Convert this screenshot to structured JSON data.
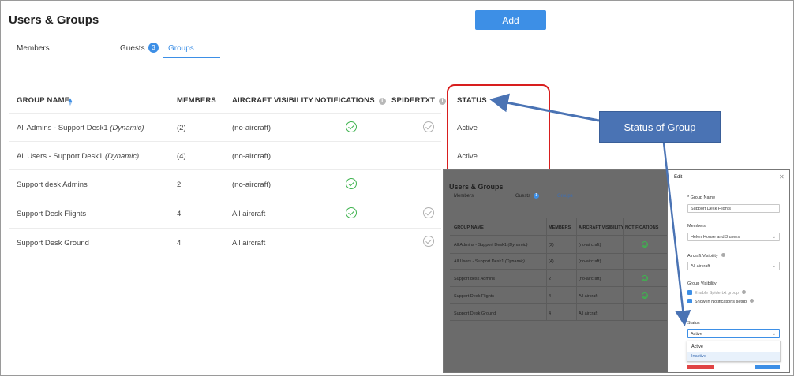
{
  "page": {
    "title": "Users & Groups",
    "add_label": "Add"
  },
  "tabs": {
    "members": "Members",
    "guests": "Guests",
    "guests_count": "3",
    "groups": "Groups",
    "active_tab": "Groups"
  },
  "table": {
    "headers": {
      "group_name": "GROUP NAME",
      "members": "MEMBERS",
      "aircraft_visibility": "AIRCRAFT VISIBILITY",
      "notifications": "NOTIFICATIONS",
      "spidertxt": "SPIDERTXT",
      "status": "STATUS"
    },
    "rows": [
      {
        "name": "All Admins - Support Desk1",
        "tag": "(Dynamic)",
        "members": "(2)",
        "aircraft": "(no-aircraft)",
        "notifications": true,
        "spidertxt": true,
        "status": "Active"
      },
      {
        "name": "All Users - Support Desk1",
        "tag": "(Dynamic)",
        "members": "(4)",
        "aircraft": "(no-aircraft)",
        "notifications": false,
        "spidertxt": false,
        "status": "Active"
      },
      {
        "name": "Support desk Admins",
        "tag": "",
        "members": "2",
        "aircraft": "(no-aircraft)",
        "notifications": true,
        "spidertxt": false,
        "status": ""
      },
      {
        "name": "Support Desk Flights",
        "tag": "",
        "members": "4",
        "aircraft": "All aircraft",
        "notifications": true,
        "spidertxt": true,
        "status": ""
      },
      {
        "name": "Support Desk Ground",
        "tag": "",
        "members": "4",
        "aircraft": "All aircraft",
        "notifications": false,
        "spidertxt": true,
        "status": ""
      }
    ]
  },
  "callout": {
    "text": "Status of Group"
  },
  "inset": {
    "title": "Users & Groups",
    "tabs": {
      "members": "Members",
      "guests": "Guests",
      "guests_count": "1",
      "groups": "Groups"
    },
    "headers": {
      "group_name": "GROUP NAME",
      "members": "MEMBERS",
      "aircraft_visibility": "AIRCRAFT VISIBILITY",
      "notifications": "NOTIFICATIONS"
    },
    "rows": [
      {
        "name": "All Admins - Support Desk1",
        "tag": "(Dynamic)",
        "members": "(2)",
        "aircraft": "(no-aircraft)",
        "notifications": true
      },
      {
        "name": "All Users - Support Desk1",
        "tag": "(Dynamic)",
        "members": "(4)",
        "aircraft": "(no-aircraft)",
        "notifications": false
      },
      {
        "name": "Support desk Admins",
        "tag": "",
        "members": "2",
        "aircraft": "(no-aircraft)",
        "notifications": true
      },
      {
        "name": "Support Desk Flights",
        "tag": "",
        "members": "4",
        "aircraft": "All aircraft",
        "notifications": true
      },
      {
        "name": "Support Desk Ground",
        "tag": "",
        "members": "4",
        "aircraft": "All aircraft",
        "notifications": false
      }
    ],
    "edit": {
      "title": "Edit",
      "group_name_label": "* Group Name",
      "group_name_value": "Support Desk Flights",
      "members_label": "Members",
      "members_value": "Helen House and 3 users",
      "aircraft_label": "Aircraft Visibility",
      "aircraft_value": "All aircraft",
      "visibility_label": "Group Visibility",
      "enable_spidertxt": "Enable Spidertxt group",
      "show_notifications": "Show in Notifications setup",
      "status_label": "Status",
      "status_value": "Active",
      "options": [
        "Active",
        "Inactive"
      ]
    }
  },
  "colors": {
    "accent": "#3d8fe6",
    "check_green": "#3fb34f",
    "highlight_red": "#d81e1e",
    "callout_blue": "#4a73b4"
  }
}
